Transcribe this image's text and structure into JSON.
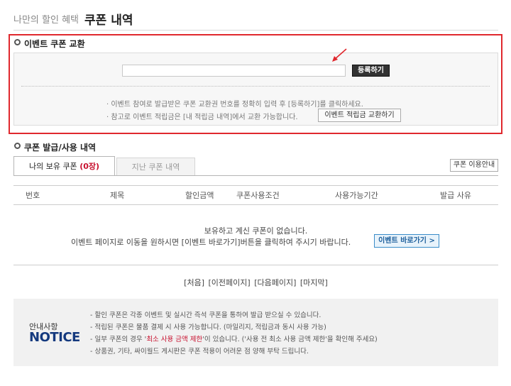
{
  "header": {
    "breadcrumb": "나만의 할인 혜택",
    "title": "쿠폰 내역"
  },
  "exchange": {
    "section_title": "이벤트 쿠폰 교환",
    "input_value": "",
    "register_label": "등록하기",
    "guide_1": "· 이벤트 참여로 발급받은 쿠폰 교환권 번호를 정확히 입력 후 [등록하기]를 클릭하세요.",
    "guide_2": "· 참고로 이벤트 적립금은 [내 적립금 내역]에서 교환 가능합니다.",
    "exchange_points_label": "이벤트 적립금 교환하기"
  },
  "history": {
    "section_title": "쿠폰 발급/사용 내역",
    "tab_mine_prefix": "나의 보유 쿠폰",
    "tab_mine_count": "(0장)",
    "tab_past": "지난 쿠폰 내역",
    "guide_button": "쿠폰 이용안내",
    "columns": [
      "번호",
      "제목",
      "할인금액",
      "쿠폰사용조건",
      "사용가능기간",
      "발급 사유"
    ],
    "empty_line_1": "보유하고 계신 쿠폰이 없습니다.",
    "empty_line_2": "이벤트 페이지로 이동을 원하시면 [이벤트 바로가기]버튼을 클릭하여 주시기 바랍니다.",
    "event_go_label": "이벤트 바로가기 >"
  },
  "pager": {
    "first": "[처음]",
    "prev": "[이전페이지]",
    "next": "[다음페이지]",
    "last": "[마지막]"
  },
  "notice": {
    "sub": "안내사항",
    "title": "NOTICE",
    "item_1": "- 할인 쿠폰은 각종 이벤트 및 실시간 즉석 쿠폰을 통하여 발급 받으실 수 있습니다.",
    "item_2": "- 적립된 쿠폰은 물품 결제 시 사용 가능합니다. (마일리지, 적립금과 동시 사용 가능)",
    "item_3_pre": "- 일부 쿠폰의 경우 '",
    "item_3_hl": "최소 사용 금액 제한",
    "item_3_post": "'이 있습니다. ('사용 전 최소 사용 금액 제한'을 확인해 주세요)",
    "item_4": "- 상품권, 기타, 싸이월드 게시판은 쿠폰 적용이 어려운 점 양해 부탁 드립니다."
  },
  "colors": {
    "highlight_box": "#e0282e",
    "notice_title": "#14397e",
    "count": "#c8102e"
  }
}
